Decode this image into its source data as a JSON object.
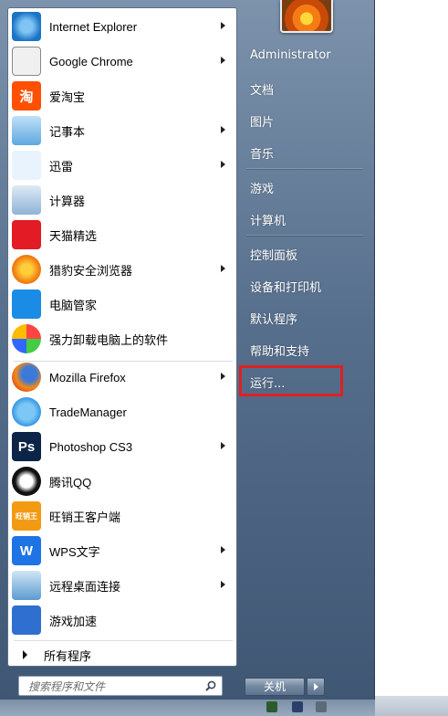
{
  "programs": [
    {
      "label": "Internet Explorer",
      "icon": "internet-explorer-icon",
      "has_submenu": true
    },
    {
      "label": "Google Chrome",
      "icon": "google-chrome-icon",
      "has_submenu": true
    },
    {
      "label": "爱淘宝",
      "icon": "ai-taobao-icon",
      "icon_text": "淘",
      "has_submenu": false
    },
    {
      "label": "记事本",
      "icon": "notepad-icon",
      "has_submenu": true
    },
    {
      "label": "迅雷",
      "icon": "xunlei-icon",
      "has_submenu": true
    },
    {
      "label": "计算器",
      "icon": "calculator-icon",
      "has_submenu": false
    },
    {
      "label": "天猫精选",
      "icon": "tmall-icon",
      "has_submenu": false
    },
    {
      "label": "猎豹安全浏览器",
      "icon": "liebao-browser-icon",
      "has_submenu": true
    },
    {
      "label": "电脑管家",
      "icon": "pc-manager-icon",
      "has_submenu": false
    },
    {
      "label": "强力卸载电脑上的软件",
      "icon": "uninstaller-icon",
      "has_submenu": false
    },
    {
      "label": "Mozilla Firefox",
      "icon": "firefox-icon",
      "has_submenu": true
    },
    {
      "label": "TradeManager",
      "icon": "trademanager-icon",
      "has_submenu": false
    },
    {
      "label": "Photoshop CS3",
      "icon": "photoshop-icon",
      "icon_text": "Ps",
      "has_submenu": true
    },
    {
      "label": "腾讯QQ",
      "icon": "qq-icon",
      "has_submenu": false
    },
    {
      "label": "旺销王客户端",
      "icon": "wangxiaowang-icon",
      "icon_text": "旺销王",
      "has_submenu": false
    },
    {
      "label": "WPS文字",
      "icon": "wps-icon",
      "icon_text": "W",
      "has_submenu": true
    },
    {
      "label": "远程桌面连接",
      "icon": "remote-desktop-icon",
      "has_submenu": true
    },
    {
      "label": "游戏加速",
      "icon": "game-accelerator-icon",
      "has_submenu": false
    }
  ],
  "all_programs_label": "所有程序",
  "search": {
    "placeholder": "搜索程序和文件"
  },
  "right_items": [
    {
      "label": "Administrator",
      "name": "right-item-administrator"
    },
    {
      "label": "文档",
      "name": "right-item-documents"
    },
    {
      "label": "图片",
      "name": "right-item-pictures"
    },
    {
      "label": "音乐",
      "name": "right-item-music"
    },
    {
      "label": "游戏",
      "name": "right-item-games"
    },
    {
      "label": "计算机",
      "name": "right-item-computer"
    },
    {
      "label": "控制面板",
      "name": "right-item-control-panel"
    },
    {
      "label": "设备和打印机",
      "name": "right-item-devices-printers"
    },
    {
      "label": "默认程序",
      "name": "right-item-default-programs"
    },
    {
      "label": "帮助和支持",
      "name": "right-item-help-support"
    },
    {
      "label": "运行...",
      "name": "right-item-run"
    }
  ],
  "shutdown": {
    "label": "关机"
  },
  "colors": {
    "highlight_box": "#e02020",
    "menu_right_bg": "#566f8c",
    "menu_left_bg": "#ffffff"
  }
}
